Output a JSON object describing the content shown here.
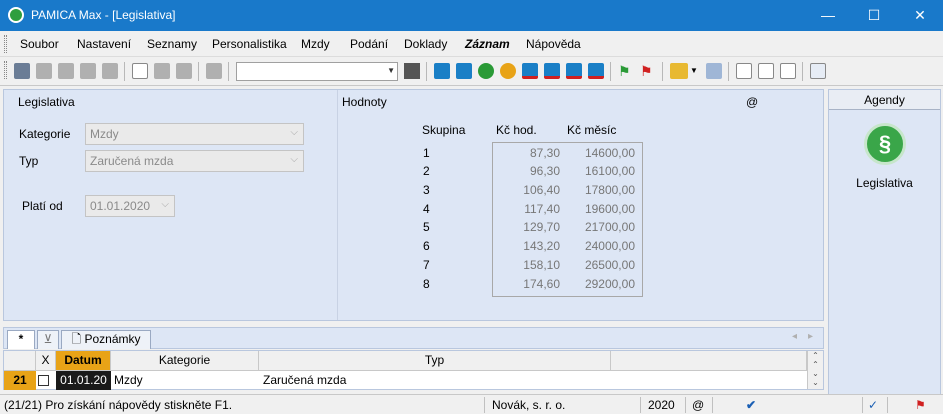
{
  "window": {
    "title": "PAMICA Max - [Legislativa]",
    "minimize": "—",
    "maximize": "☐",
    "close": "✕"
  },
  "menu": [
    "Soubor",
    "Nastavení",
    "Seznamy",
    "Personalistika",
    "Mzdy",
    "Podání",
    "Doklady",
    "Záznam",
    "Nápověda"
  ],
  "toolbar": {
    "combo_value": ""
  },
  "left": {
    "section": "Legislativa",
    "kategorie_label": "Kategorie",
    "kategorie_value": "Mzdy",
    "typ_label": "Typ",
    "typ_value": "Zaručená mzda",
    "plati_label": "Platí od",
    "plati_value": "01.01.2020"
  },
  "right": {
    "section": "Hodnoty",
    "at": "@",
    "col_skupina": "Skupina",
    "col_hod": "Kč hod.",
    "col_mesic": "Kč měsíc",
    "rows": [
      {
        "g": "1",
        "h": "87,30",
        "m": "14600,00"
      },
      {
        "g": "2",
        "h": "96,30",
        "m": "16100,00"
      },
      {
        "g": "3",
        "h": "106,40",
        "m": "17800,00"
      },
      {
        "g": "4",
        "h": "117,40",
        "m": "19600,00"
      },
      {
        "g": "5",
        "h": "129,70",
        "m": "21700,00"
      },
      {
        "g": "6",
        "h": "143,20",
        "m": "24000,00"
      },
      {
        "g": "7",
        "h": "158,10",
        "m": "26500,00"
      },
      {
        "g": "8",
        "h": "174,60",
        "m": "29200,00"
      }
    ]
  },
  "agendy": {
    "header": "Agendy",
    "item": "Legislativa",
    "logo": "§"
  },
  "tabs": {
    "star": "*",
    "filter": "⊻",
    "notes": "Poznámky"
  },
  "grid": {
    "headers": {
      "x": "X",
      "datum": "Datum",
      "kategorie": "Kategorie",
      "typ": "Typ"
    },
    "row": {
      "num": "21",
      "datum": "01.01.20",
      "kategorie": "Mzdy",
      "typ": "Zaručená mzda"
    }
  },
  "status": {
    "help": "(21/21) Pro získání nápovědy stiskněte F1.",
    "company": "Novák, s. r. o.",
    "year": "2020",
    "at": "@"
  },
  "colors": {
    "titlebar": "#1979ca",
    "panel": "#dde6f5",
    "datum_header": "#e8a317",
    "row_num": "#e8a317"
  }
}
